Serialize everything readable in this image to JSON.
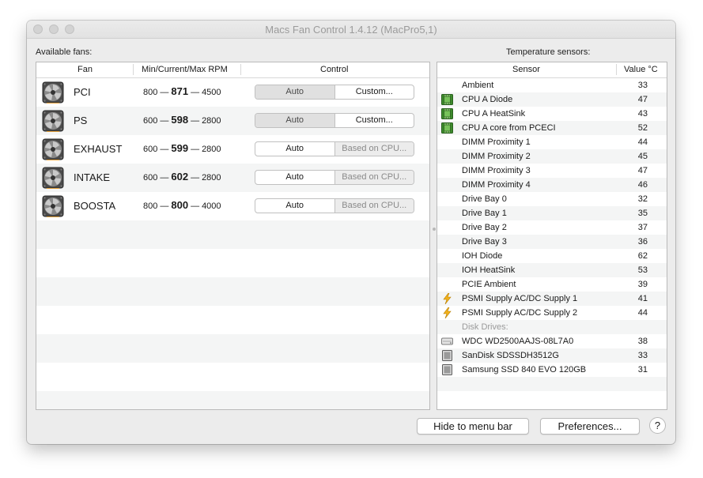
{
  "window": {
    "title": "Macs Fan Control 1.4.12 (MacPro5,1)"
  },
  "fans_section": {
    "label": "Available fans:",
    "columns": {
      "fan": "Fan",
      "rpm": "Min/Current/Max RPM",
      "control": "Control"
    },
    "fans": [
      {
        "name": "PCI",
        "min": "800",
        "current": "871",
        "max": "4500",
        "left": "Auto",
        "right": "Custom...",
        "mode": "auto"
      },
      {
        "name": "PS",
        "min": "600",
        "current": "598",
        "max": "2800",
        "left": "Auto",
        "right": "Custom...",
        "mode": "auto"
      },
      {
        "name": "EXHAUST",
        "min": "600",
        "current": "599",
        "max": "2800",
        "left": "Auto",
        "right": "Based on CPU...",
        "mode": "sensor"
      },
      {
        "name": "INTAKE",
        "min": "600",
        "current": "602",
        "max": "2800",
        "left": "Auto",
        "right": "Based on CPU...",
        "mode": "sensor"
      },
      {
        "name": "BOOSTA",
        "min": "800",
        "current": "800",
        "max": "4000",
        "left": "Auto",
        "right": "Based on CPU...",
        "mode": "sensor"
      }
    ],
    "separator": "—"
  },
  "sensors_section": {
    "label": "Temperature sensors:",
    "columns": {
      "sensor": "Sensor",
      "value": "Value °C"
    },
    "sensors": [
      {
        "name": "Ambient",
        "value": "33",
        "icon": "none"
      },
      {
        "name": "CPU A Diode",
        "value": "47",
        "icon": "chip-icon"
      },
      {
        "name": "CPU A HeatSink",
        "value": "43",
        "icon": "chip-icon"
      },
      {
        "name": "CPU A core from PCECI",
        "value": "52",
        "icon": "chip-icon"
      },
      {
        "name": "DIMM Proximity 1",
        "value": "44",
        "icon": "none"
      },
      {
        "name": "DIMM Proximity 2",
        "value": "45",
        "icon": "none"
      },
      {
        "name": "DIMM Proximity 3",
        "value": "47",
        "icon": "none"
      },
      {
        "name": "DIMM Proximity 4",
        "value": "46",
        "icon": "none"
      },
      {
        "name": "Drive Bay 0",
        "value": "32",
        "icon": "none"
      },
      {
        "name": "Drive Bay 1",
        "value": "35",
        "icon": "none"
      },
      {
        "name": "Drive Bay 2",
        "value": "37",
        "icon": "none"
      },
      {
        "name": "Drive Bay 3",
        "value": "36",
        "icon": "none"
      },
      {
        "name": "IOH Diode",
        "value": "62",
        "icon": "none"
      },
      {
        "name": "IOH HeatSink",
        "value": "53",
        "icon": "none"
      },
      {
        "name": "PCIE Ambient",
        "value": "39",
        "icon": "none"
      },
      {
        "name": "PSMI Supply AC/DC Supply 1",
        "value": "41",
        "icon": "lightning-icon"
      },
      {
        "name": "PSMI Supply AC/DC Supply 2",
        "value": "44",
        "icon": "lightning-icon"
      },
      {
        "name": "Disk Drives:",
        "value": "",
        "icon": "none",
        "group": true
      },
      {
        "name": "WDC WD2500AAJS-08L7A0",
        "value": "38",
        "icon": "hdd-icon"
      },
      {
        "name": "SanDisk SDSSDH3512G",
        "value": "33",
        "icon": "ssd-icon"
      },
      {
        "name": "Samsung SSD 840 EVO 120GB",
        "value": "31",
        "icon": "ssd-icon"
      }
    ]
  },
  "buttons": {
    "hide": "Hide to menu bar",
    "preferences": "Preferences...",
    "help": "?"
  }
}
